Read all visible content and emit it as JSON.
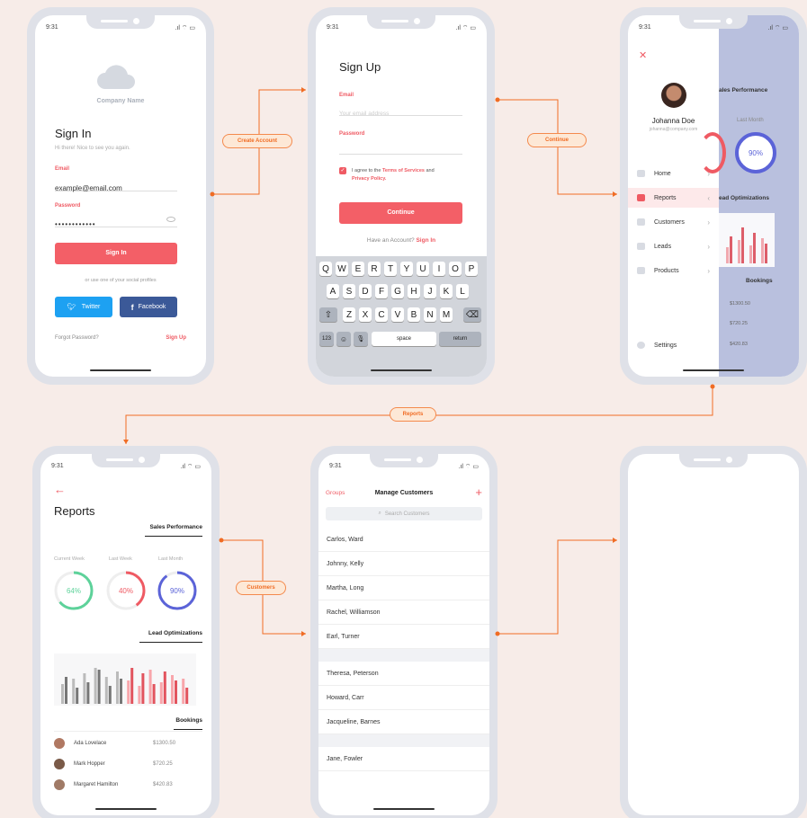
{
  "status": {
    "time": "9:31"
  },
  "signin": {
    "company": "Company Name",
    "title": "Sign In",
    "subtitle": "Hi there! Nice to see you again.",
    "email_label": "Email",
    "email_value": "example@email.com",
    "password_label": "Password",
    "password_value": "••••••••••••",
    "button": "Sign In",
    "social_text": "or use one of your social profiles",
    "twitter": "Twitter",
    "facebook": "Facebook",
    "forgot": "Forgot Password?",
    "signup": "Sign Up"
  },
  "signup": {
    "title": "Sign Up",
    "email_label": "Email",
    "email_placeholder": "Your email address",
    "password_label": "Password",
    "agree_prefix": "I agree to the ",
    "terms": "Terms of Services",
    "agree_and": " and",
    "privacy": "Privacy Policy.",
    "button": "Continue",
    "have_account": "Have an Account?",
    "signin_link": "Sign In",
    "keys_row1": [
      "Q",
      "W",
      "E",
      "R",
      "T",
      "Y",
      "U",
      "I",
      "O",
      "P"
    ],
    "keys_row2": [
      "A",
      "S",
      "D",
      "F",
      "G",
      "H",
      "J",
      "K",
      "L"
    ],
    "keys_row3": [
      "Z",
      "X",
      "C",
      "V",
      "B",
      "N",
      "M"
    ],
    "key_123": "123",
    "key_space": "space",
    "key_return": "return"
  },
  "menu": {
    "name": "Johanna Doe",
    "email": "johanna@company.com",
    "items": [
      "Home",
      "Reports",
      "Customers",
      "Leads",
      "Products"
    ],
    "settings": "Settings",
    "bg_sales": "ales Performance",
    "bg_lastmonth": "Last Month",
    "bg_ring": "90%",
    "bg_lead": "ead Optimizations",
    "bg_bookings": "Bookings",
    "bg_amounts": [
      "$1300.50",
      "$720.25",
      "$420.83"
    ]
  },
  "reports": {
    "title": "Reports",
    "sales_tab": "Sales Performance",
    "periods": [
      "Current Week",
      "Last Week",
      "Last Month"
    ],
    "rings": [
      "64%",
      "40%",
      "90%"
    ],
    "ring_values": [
      0.64,
      0.4,
      0.9
    ],
    "ring_colors": [
      "#5dd29a",
      "#ef5a63",
      "#5b63d8"
    ],
    "lead_tab": "Lead Optimizations",
    "bookings_tab": "Bookings",
    "bookings": [
      {
        "name": "Ada Lovelace",
        "amount": "$1300.50"
      },
      {
        "name": "Mark Hopper",
        "amount": "$720.25"
      },
      {
        "name": "Margaret Hamilton",
        "amount": "$420.83"
      }
    ]
  },
  "customers": {
    "groups": "Groups",
    "title": "Manage Customers",
    "plus": "+",
    "search_placeholder": "Search Customers",
    "group1": [
      "Carlos, Ward",
      "Johnny, Kelly",
      "Martha, Long",
      "Rachel, Williamson",
      "Earl, Turner"
    ],
    "group2": [
      "Theresa, Peterson",
      "Howard, Carr",
      "Jacqueline, Barnes"
    ],
    "group3": [
      "Jane, Fowler"
    ]
  },
  "flow": {
    "create_account": "Create Account",
    "continue": "Continue",
    "reports": "Reports",
    "customers": "Customers"
  },
  "colors": {
    "accent": "#ef5a63",
    "flow": "#f06c24",
    "twitter": "#1da1f2",
    "facebook": "#3b5998",
    "menu_overlay": "#b9c0de"
  }
}
